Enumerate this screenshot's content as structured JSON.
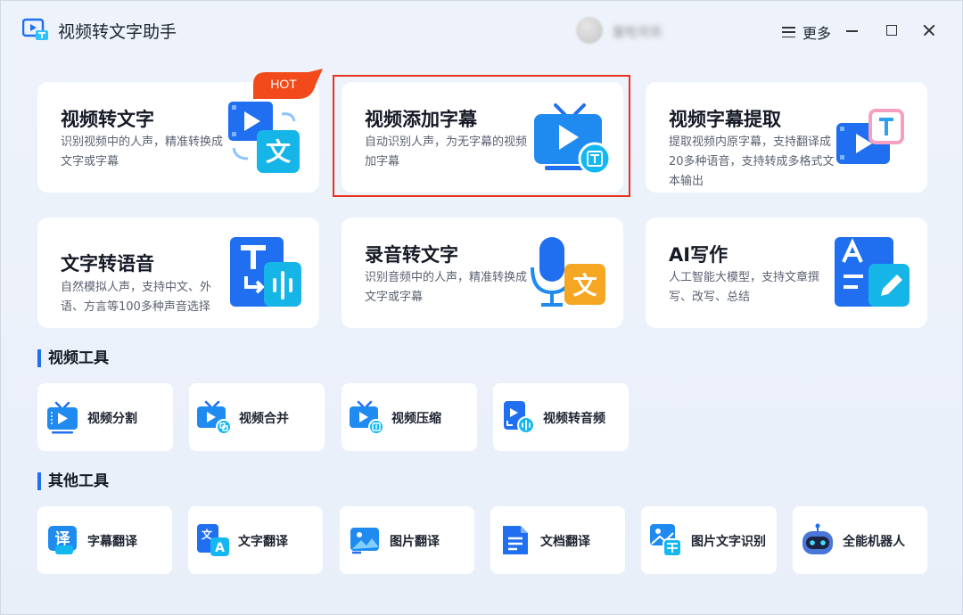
{
  "app": {
    "title": "视频转文字助手",
    "username": "爱吃可乐",
    "more_label": "更多"
  },
  "colors": {
    "accent": "#1f6ff0",
    "hot": "#f24a1a",
    "selection": "#e8321e"
  },
  "feature_cards": [
    {
      "title": "视频转文字",
      "desc": "识别视频中的人声，精准转换成文字或字幕",
      "icon": "video-to-text-icon",
      "badge": "HOT"
    },
    {
      "title": "视频添加字幕",
      "desc": "自动识别人声，为无字幕的视频加字幕",
      "icon": "tv-subtitle-icon"
    },
    {
      "title": "视频字幕提取",
      "desc": "提取视频内原字幕，支持翻译成20多种语音，支持转成多格式文本输出",
      "icon": "subtitle-extract-icon"
    },
    {
      "title": "文字转语音",
      "desc": "自然模拟人声，支持中文、外语、方言等100多种声音选择",
      "icon": "text-to-speech-icon"
    },
    {
      "title": "录音转文字",
      "desc": "识别音频中的人声，精准转换成文字或字幕",
      "icon": "audio-to-text-icon"
    },
    {
      "title": "AI写作",
      "desc": "人工智能大模型，支持文章撰写、改写、总结",
      "icon": "ai-writing-icon"
    }
  ],
  "video_tools": {
    "title": "视频工具",
    "items": [
      {
        "label": "视频分割",
        "icon": "video-split-icon"
      },
      {
        "label": "视频合并",
        "icon": "video-merge-icon"
      },
      {
        "label": "视频压缩",
        "icon": "video-compress-icon"
      },
      {
        "label": "视频转音频",
        "icon": "video-to-audio-icon"
      }
    ]
  },
  "other_tools": {
    "title": "其他工具",
    "items": [
      {
        "label": "字幕翻译",
        "icon": "subtitle-translate-icon"
      },
      {
        "label": "文字翻译",
        "icon": "text-translate-icon"
      },
      {
        "label": "图片翻译",
        "icon": "image-translate-icon"
      },
      {
        "label": "文档翻译",
        "icon": "document-translate-icon"
      },
      {
        "label": "图片文字识别",
        "icon": "image-ocr-icon"
      },
      {
        "label": "全能机器人",
        "icon": "robot-icon"
      }
    ]
  }
}
